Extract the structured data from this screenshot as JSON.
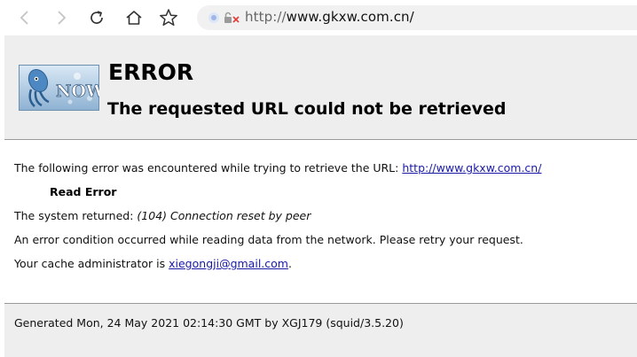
{
  "browser": {
    "address_protocol": "http://",
    "address_host": "www.gkxw.com.cn/",
    "icons": [
      "back-arrow-icon",
      "forward-arrow-icon",
      "reload-icon",
      "home-icon",
      "star-icon",
      "site-info-icon",
      "insecure-lock-icon"
    ]
  },
  "header": {
    "logo_text": "NOW",
    "title": "ERROR",
    "subtitle": "The requested URL could not be retrieved"
  },
  "content": {
    "line1_prefix": "The following error was encountered while trying to retrieve the URL: ",
    "line1_url": "http://www.gkxw.com.cn/",
    "error_name": "Read Error",
    "line2_prefix": "The system returned: ",
    "line2_detail": "(104) Connection reset by peer",
    "line3": "An error condition occurred while reading data from the network. Please retry your request.",
    "line4_prefix": "Your cache administrator is ",
    "line4_email": "xiegongji@gmail.com",
    "line4_suffix": "."
  },
  "footer": {
    "text": "Generated Mon, 24 May 2021 02:14:30 GMT by XGJ179 (squid/3.5.20)"
  },
  "colors": {
    "header_bg": "#eeeeee",
    "link": "#1a1aa6"
  }
}
